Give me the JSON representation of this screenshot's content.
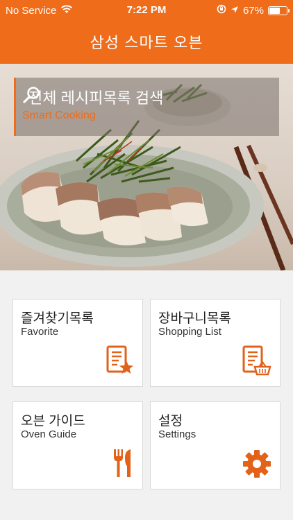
{
  "status_bar": {
    "carrier": "No Service",
    "time": "7:22 PM",
    "battery_percent": "67%",
    "battery_level": 0.67
  },
  "header": {
    "title": "삼성 스마트 오븐"
  },
  "search": {
    "title": "전체 레시피목록 검색",
    "subtitle": "Smart Cooking"
  },
  "tiles": [
    {
      "title": "즐겨찾기목록",
      "subtitle": "Favorite",
      "icon": "favorite-list-icon"
    },
    {
      "title": "장바구니목록",
      "subtitle": "Shopping List",
      "icon": "shopping-list-icon"
    },
    {
      "title": "오븐 가이드",
      "subtitle": "Oven Guide",
      "icon": "utensils-icon"
    },
    {
      "title": "설정",
      "subtitle": "Settings",
      "icon": "gear-icon"
    }
  ],
  "colors": {
    "accent": "#ee6c1a",
    "background": "#f1f1f1",
    "tile": "#ffffff"
  }
}
